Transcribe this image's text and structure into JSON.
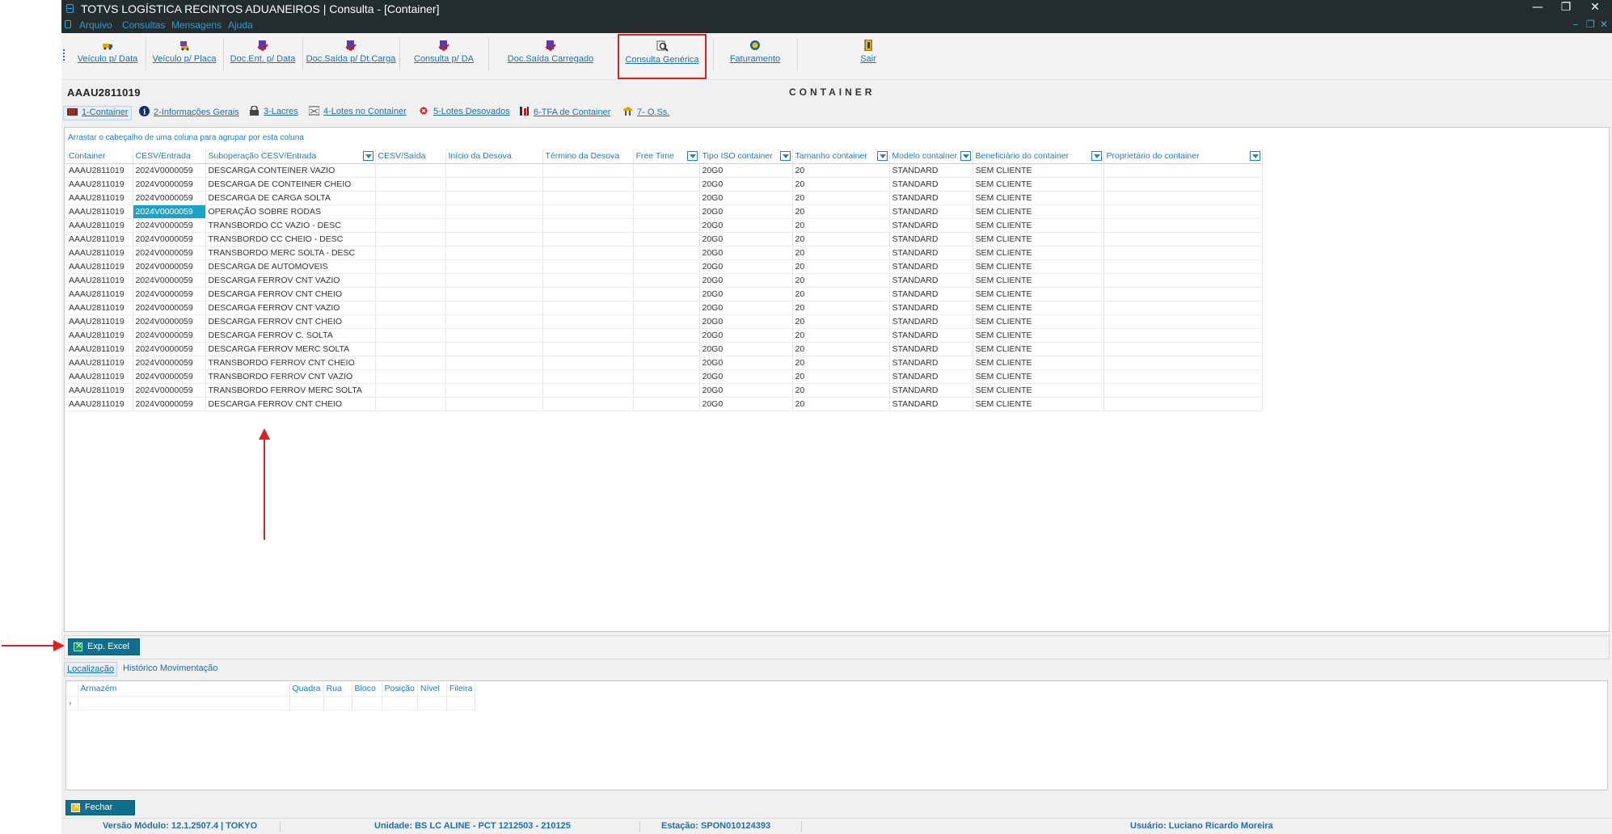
{
  "window": {
    "title": "TOTVS LOGÍSTICA RECINTOS ADUANEIROS | Consulta - [Container]",
    "minimize": "—",
    "restore": "❐",
    "close": "✕",
    "mdi_minimize": "–",
    "mdi_restore": "❐",
    "mdi_close": "✕"
  },
  "menu": [
    "Arquivo",
    "Consultas",
    "Mensagens",
    "Ajuda"
  ],
  "toolbar": {
    "buttons": [
      {
        "label": "Veículo p/ Data",
        "icon": "truck-calendar-icon"
      },
      {
        "label": "Veículo p/ Placa",
        "icon": "truck-plate-icon"
      },
      {
        "label": "Doc.Ent. p/ Data",
        "icon": "doc-in-icon"
      },
      {
        "label": "Doc.Saída p/ Dt.Carga",
        "icon": "doc-out-icon"
      },
      {
        "label": "Consulta p/ DA",
        "icon": "doc-search-icon"
      },
      {
        "label": "Doc.Saída Carregado",
        "icon": "doc-loaded-icon"
      },
      {
        "label": "Consulta Genérica",
        "icon": "magnifier-icon"
      },
      {
        "label": "Faturamento",
        "icon": "coin-icon"
      },
      {
        "label": "Sair",
        "icon": "exit-door-icon"
      }
    ]
  },
  "record_id": "AAAU2811019",
  "screen_title": "CONTAINER",
  "tabs": [
    {
      "label": "1-Container",
      "icon": "container-icon"
    },
    {
      "label": "2-Informações Gerais",
      "icon": "info-icon"
    },
    {
      "label": "3-Lacres",
      "icon": "lock-icon"
    },
    {
      "label": "4-Lotes no Container",
      "icon": "lots-icon"
    },
    {
      "label": "5-Lotes Desovados",
      "icon": "unloaded-icon"
    },
    {
      "label": "6-TFA de Container",
      "icon": "tools-icon"
    },
    {
      "label": "7- O.Ss.",
      "icon": "service-order-icon"
    }
  ],
  "grid": {
    "group_hint": "Arrastar o cabeçalho de uma coluna para agrupar por esta coluna",
    "columns": [
      {
        "label": "Container",
        "filter": false
      },
      {
        "label": "CESV/Entrada",
        "filter": false
      },
      {
        "label": "Suboperação CESV/Entrada",
        "filter": true
      },
      {
        "label": "CESV/Saída",
        "filter": false
      },
      {
        "label": "Início da Desova",
        "filter": false
      },
      {
        "label": "Término da Desova",
        "filter": false
      },
      {
        "label": "Free Time",
        "filter": true
      },
      {
        "label": "Tipo ISO container",
        "filter": true
      },
      {
        "label": "Tamanho container",
        "filter": true
      },
      {
        "label": "Modelo container",
        "filter": true
      },
      {
        "label": "Beneficiário do container",
        "filter": true
      },
      {
        "label": "Proprietário do container",
        "filter": true
      }
    ],
    "rows": [
      [
        "AAAU2811019",
        "2024V0000059",
        "DESCARGA CONTEINER VAZIO",
        "",
        "",
        "",
        "",
        "20G0",
        "20",
        "STANDARD",
        "SEM CLIENTE",
        ""
      ],
      [
        "AAAU2811019",
        "2024V0000059",
        "DESCARGA DE CONTEINER CHEIO",
        "",
        "",
        "",
        "",
        "20G0",
        "20",
        "STANDARD",
        "SEM CLIENTE",
        ""
      ],
      [
        "AAAU2811019",
        "2024V0000059",
        "DESCARGA DE CARGA SOLTA",
        "",
        "",
        "",
        "",
        "20G0",
        "20",
        "STANDARD",
        "SEM CLIENTE",
        ""
      ],
      [
        "AAAU2811019",
        "2024V0000059",
        "OPERAÇÃO SOBRE RODAS",
        "",
        "",
        "",
        "",
        "20G0",
        "20",
        "STANDARD",
        "SEM CLIENTE",
        ""
      ],
      [
        "AAAU2811019",
        "2024V0000059",
        "TRANSBORDO CC VAZIO - DESC",
        "",
        "",
        "",
        "",
        "20G0",
        "20",
        "STANDARD",
        "SEM CLIENTE",
        ""
      ],
      [
        "AAAU2811019",
        "2024V0000059",
        "TRANSBORDO CC CHEIO - DESC",
        "",
        "",
        "",
        "",
        "20G0",
        "20",
        "STANDARD",
        "SEM CLIENTE",
        ""
      ],
      [
        "AAAU2811019",
        "2024V0000059",
        "TRANSBORDO MERC SOLTA - DESC",
        "",
        "",
        "",
        "",
        "20G0",
        "20",
        "STANDARD",
        "SEM CLIENTE",
        ""
      ],
      [
        "AAAU2811019",
        "2024V0000059",
        "DESCARGA DE AUTOMOVEIS",
        "",
        "",
        "",
        "",
        "20G0",
        "20",
        "STANDARD",
        "SEM CLIENTE",
        ""
      ],
      [
        "AAAU2811019",
        "2024V0000059",
        "DESCARGA FERROV CNT VAZIO",
        "",
        "",
        "",
        "",
        "20G0",
        "20",
        "STANDARD",
        "SEM CLIENTE",
        ""
      ],
      [
        "AAAU2811019",
        "2024V0000059",
        "DESCARGA FERROV CNT CHEIO",
        "",
        "",
        "",
        "",
        "20G0",
        "20",
        "STANDARD",
        "SEM CLIENTE",
        ""
      ],
      [
        "AAAU2811019",
        "2024V0000059",
        "DESCARGA FERROV CNT VAZIO",
        "",
        "",
        "",
        "",
        "20G0",
        "20",
        "STANDARD",
        "SEM CLIENTE",
        ""
      ],
      [
        "AAAU2811019",
        "2024V0000059",
        "DESCARGA FERROV CNT CHEIO",
        "",
        "",
        "",
        "",
        "20G0",
        "20",
        "STANDARD",
        "SEM CLIENTE",
        ""
      ],
      [
        "AAAU2811019",
        "2024V0000059",
        "DESCARGA FERROV C. SOLTA",
        "",
        "",
        "",
        "",
        "20G0",
        "20",
        "STANDARD",
        "SEM CLIENTE",
        ""
      ],
      [
        "AAAU2811019",
        "2024V0000059",
        "DESCARGA FERROV MERC SOLTA",
        "",
        "",
        "",
        "",
        "20G0",
        "20",
        "STANDARD",
        "SEM CLIENTE",
        ""
      ],
      [
        "AAAU2811019",
        "2024V0000059",
        "TRANSBORDO FERROV CNT CHEIO",
        "",
        "",
        "",
        "",
        "20G0",
        "20",
        "STANDARD",
        "SEM CLIENTE",
        ""
      ],
      [
        "AAAU2811019",
        "2024V0000059",
        "TRANSBORDO FERROV CNT VAZIO",
        "",
        "",
        "",
        "",
        "20G0",
        "20",
        "STANDARD",
        "SEM CLIENTE",
        ""
      ],
      [
        "AAAU2811019",
        "2024V0000059",
        "TRANSBORDO FERROV MERC SOLTA",
        "",
        "",
        "",
        "",
        "20G0",
        "20",
        "STANDARD",
        "SEM CLIENTE",
        ""
      ],
      [
        "AAAU2811019",
        "2024V0000059",
        "DESCARGA FERROV CNT CHEIO",
        "",
        "",
        "",
        "",
        "20G0",
        "20",
        "STANDARD",
        "SEM CLIENTE",
        ""
      ]
    ],
    "selected_row": 3,
    "selected_col": 1
  },
  "export_button": {
    "label": "Exp. Excel",
    "icon": "excel-icon"
  },
  "bottom_tabs": [
    "Localização",
    "Histórico Movimentação"
  ],
  "location_grid": {
    "columns": [
      "Armazém",
      "Quadra",
      "Rua",
      "Bloco",
      "Posição",
      "Nível",
      "Fileira"
    ],
    "row_indicator": "›"
  },
  "close_button": {
    "label": "Fechar",
    "icon": "close-door-icon"
  },
  "status": {
    "version": "Versão Módulo:   12.1.2507.4  |  TOKYO",
    "unit": "Unidade: BS LC ALINE - PCT 1212503 - 210125",
    "station": "Estação: SPON010124393",
    "user": "Usuário: Luciano Ricardo Moreira"
  },
  "colors": {
    "titlebar": "#252c2e",
    "accent": "#1f7db8",
    "selection": "#1aa3c8",
    "button": "#0f6f8c",
    "annotation": "#e02020"
  }
}
